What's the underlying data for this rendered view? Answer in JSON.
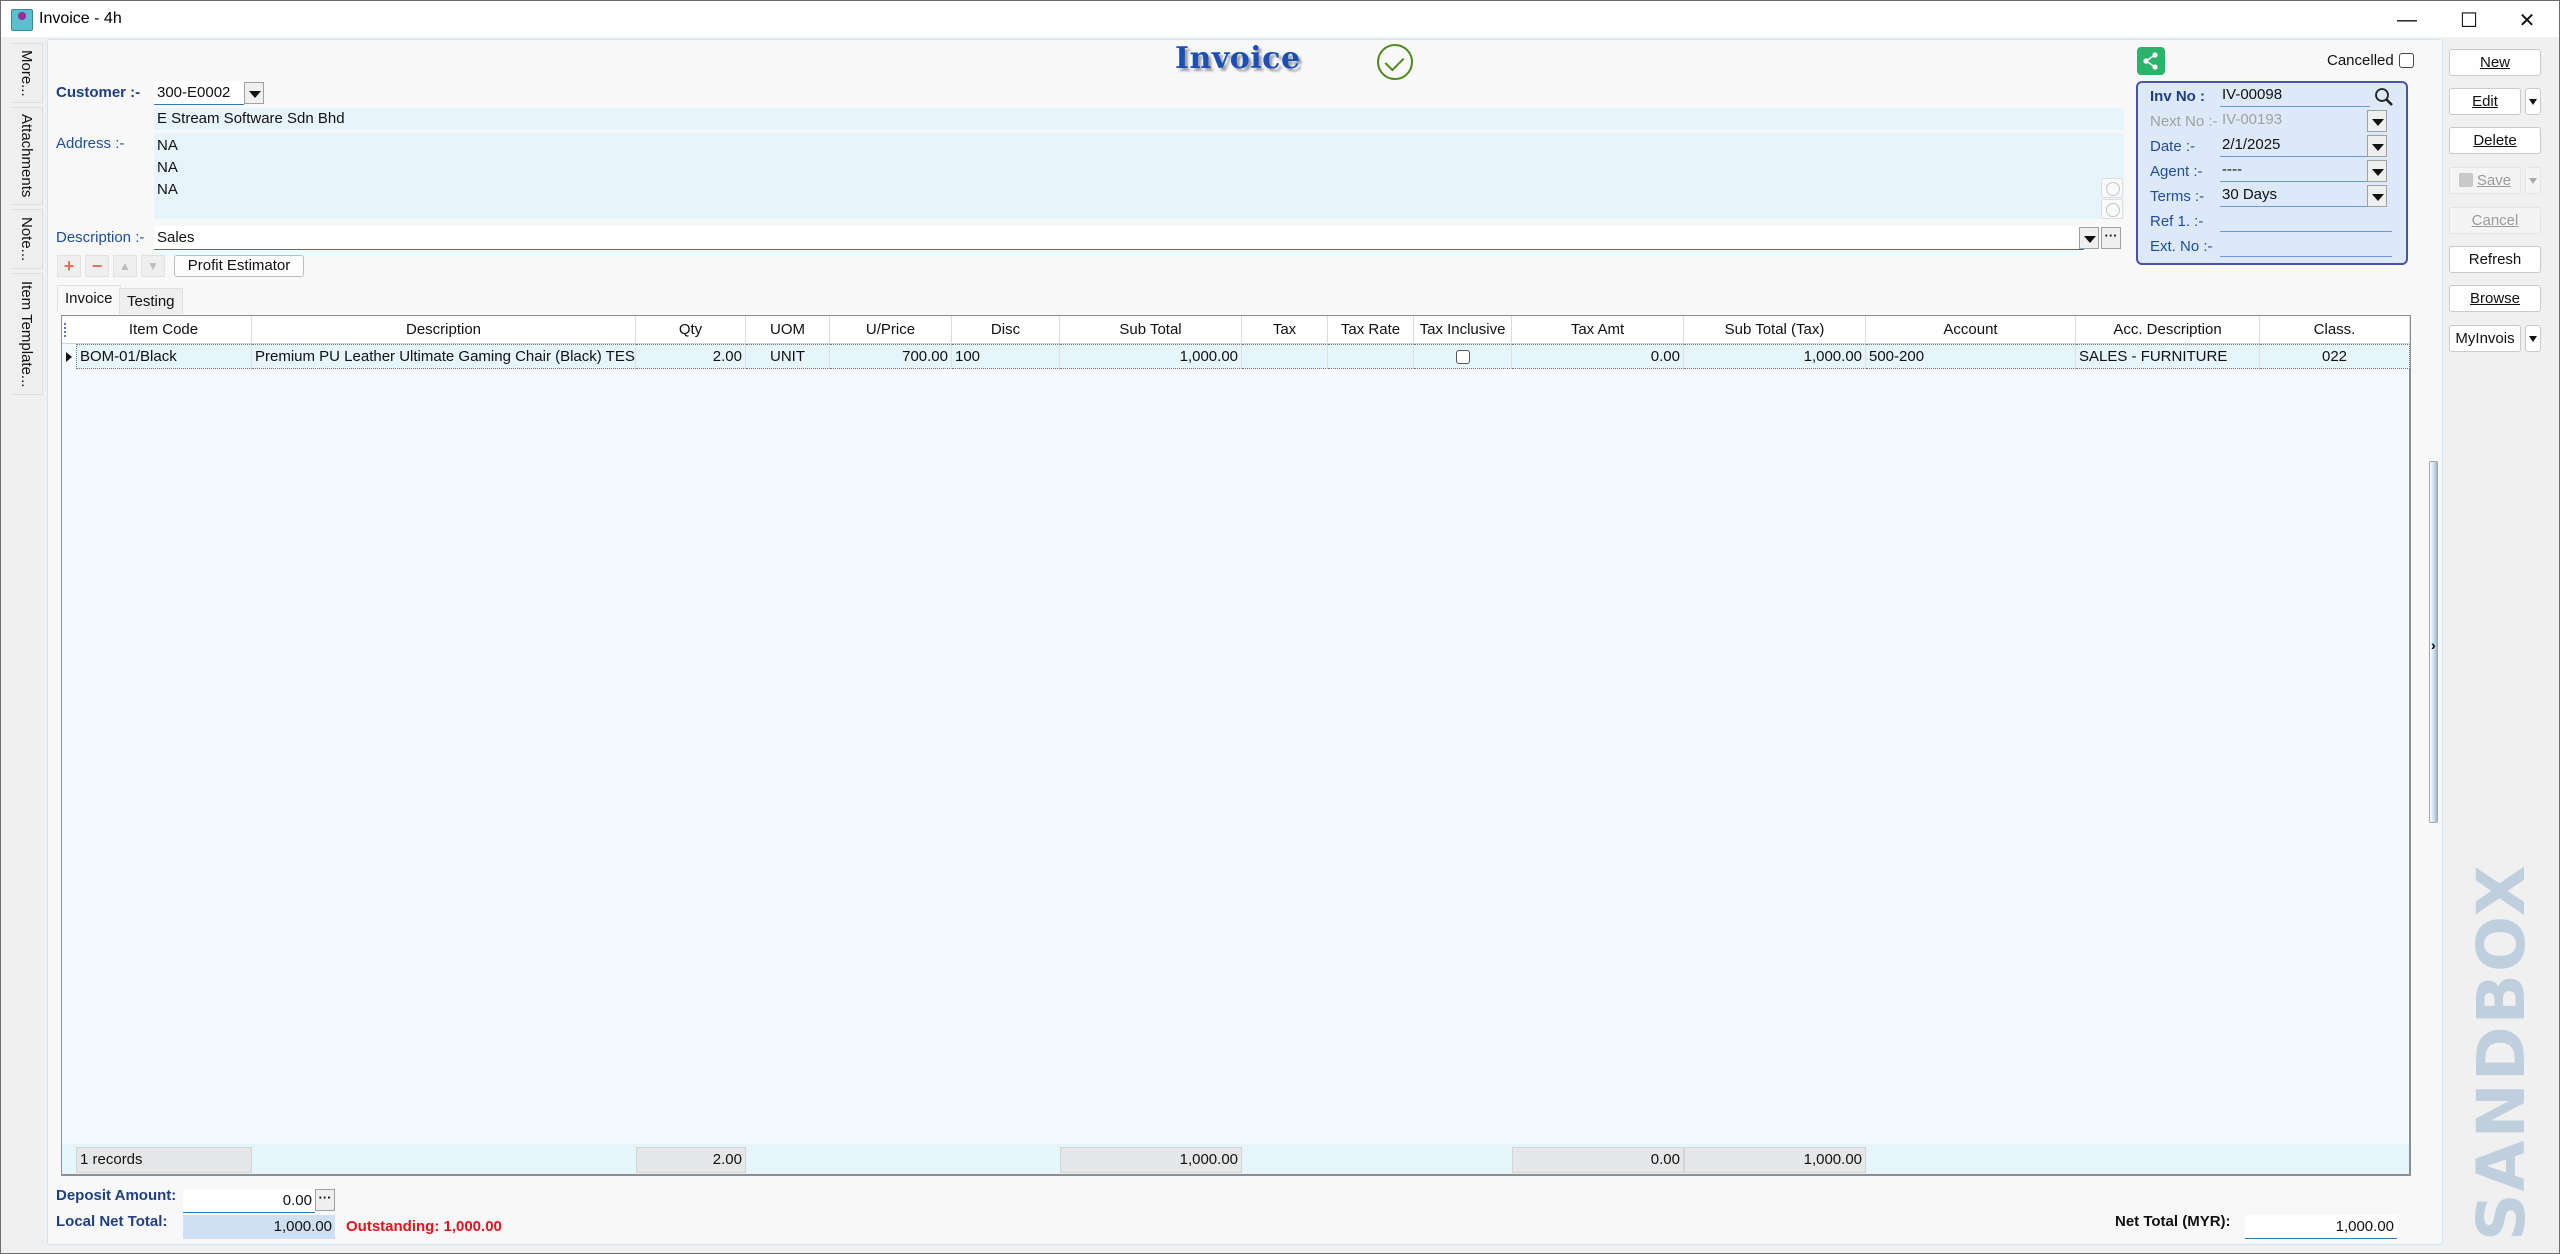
{
  "window": {
    "title": "Invoice - 4h",
    "controls": {
      "minimize": "—",
      "maximize": "☐",
      "close": "✕"
    }
  },
  "side_tabs": [
    "More...",
    "Attachments",
    "Note...",
    "Item Template..."
  ],
  "header": {
    "doc_title": "Invoice",
    "status_icon": "approved-check-icon"
  },
  "customer": {
    "label": "Customer :-",
    "code": "300-E0002",
    "name": "E Stream Software Sdn Bhd",
    "address_label": "Address :-",
    "address_lines": [
      "NA",
      "NA",
      "NA",
      ""
    ],
    "description_label": "Description :-",
    "description": "Sales"
  },
  "toolbar": {
    "add": "+",
    "remove": "−",
    "move_up": "▲",
    "move_down": "▼",
    "profit_estimator": "Profit Estimator"
  },
  "tabs": [
    {
      "label": "Invoice",
      "active": true
    },
    {
      "label": "Testing",
      "active": false
    }
  ],
  "grid": {
    "columns": [
      "Item Code",
      "Description",
      "Qty",
      "UOM",
      "U/Price",
      "Disc",
      "Sub Total",
      "Tax",
      "Tax Rate",
      "Tax Inclusive",
      "Tax Amt",
      "Sub Total (Tax)",
      "Account",
      "Acc. Description",
      "Class."
    ],
    "rows": [
      {
        "item_code": "BOM-01/Black",
        "description": "Premium PU Leather Ultimate Gaming Chair (Black) TEST",
        "qty": "2.00",
        "uom": "UNIT",
        "unit_price": "700.00",
        "disc": "100",
        "sub_total": "1,000.00",
        "tax": "",
        "tax_rate": "",
        "tax_inclusive": false,
        "tax_amt": "0.00",
        "sub_total_tax": "1,000.00",
        "account": "500-200",
        "acc_description": "SALES - FURNITURE",
        "class": "022"
      }
    ],
    "footer": {
      "records": "1 records",
      "qty": "2.00",
      "sub_total": "1,000.00",
      "tax_amt": "0.00",
      "sub_total_tax": "1,000.00"
    }
  },
  "doc_panel": {
    "cancelled_label": "Cancelled",
    "cancelled": false,
    "inv_no_label": "Inv No :",
    "inv_no": "IV-00098",
    "next_no_label": "Next No :-",
    "next_no": "IV-00193",
    "date_label": "Date :-",
    "date": "2/1/2025",
    "agent_label": "Agent :-",
    "agent": "----",
    "terms_label": "Terms :-",
    "terms": "30 Days",
    "ref1_label": "Ref 1. :-",
    "ref1": "",
    "ext_no_label": "Ext. No :-",
    "ext_no": ""
  },
  "actions": {
    "new": "New",
    "edit": "Edit",
    "delete": "Delete",
    "save": "Save",
    "cancel": "Cancel",
    "refresh": "Refresh",
    "browse": "Browse",
    "myinvois": "MyInvois"
  },
  "totals": {
    "deposit_label": "Deposit Amount:",
    "deposit": "0.00",
    "local_net_label": "Local Net Total:",
    "local_net": "1,000.00",
    "outstanding": "Outstanding: 1,000.00",
    "net_total_label": "Net Total (MYR):",
    "net_total": "1,000.00"
  },
  "watermark": "SANDBOX",
  "colors": {
    "label_blue": "#1e4ea0",
    "outstanding_red": "#e8101a",
    "share_green": "#2bb36b",
    "approved_green": "#4d8a1c",
    "panel_border": "#4a54a6"
  }
}
